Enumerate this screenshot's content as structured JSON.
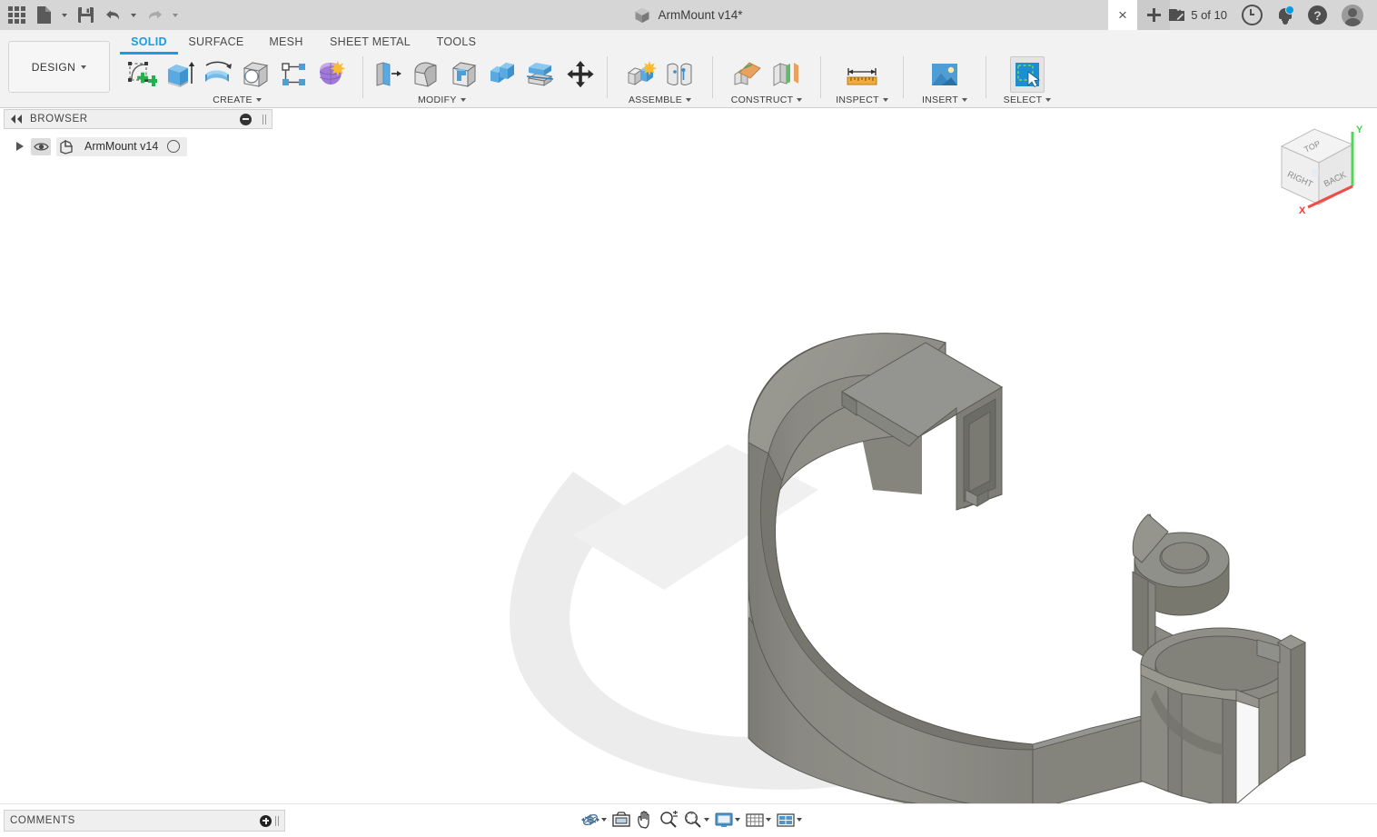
{
  "window": {
    "title": "ArmMount v14*",
    "doc_icon": "cube-icon"
  },
  "quick_access": {
    "apps_label": "apps-grid-icon",
    "new_label": "new-document-icon",
    "save_label": "save-icon",
    "undo_label": "undo-icon",
    "redo_label": "redo-icon"
  },
  "title_right": {
    "close_label": "×",
    "new_tab_label": "+",
    "jobs_count": "5 of 10",
    "jobs_icon": "job-status-icon",
    "clock_icon": "recent-clock-icon",
    "bell_icon": "notifications-bell-icon",
    "help_icon": "help-question-icon",
    "avatar_icon": "user-avatar-icon"
  },
  "ribbon": {
    "workspace": "DESIGN",
    "tabs": [
      {
        "label": "SOLID",
        "active": true
      },
      {
        "label": "SURFACE",
        "active": false
      },
      {
        "label": "MESH",
        "active": false
      },
      {
        "label": "SHEET METAL",
        "active": false
      },
      {
        "label": "TOOLS",
        "active": false
      }
    ],
    "groups": [
      {
        "label": "CREATE",
        "has_dropdown": true,
        "items": [
          {
            "name": "create-sketch",
            "icon": "sketch-plus-icon"
          },
          {
            "name": "extrude",
            "icon": "extrude-icon"
          },
          {
            "name": "revolve",
            "icon": "revolve-icon"
          },
          {
            "name": "hole",
            "icon": "hole-icon"
          },
          {
            "name": "pattern",
            "icon": "rectangular-pattern-icon"
          },
          {
            "name": "create-form",
            "icon": "create-form-icon"
          }
        ]
      },
      {
        "label": "MODIFY",
        "has_dropdown": true,
        "items": [
          {
            "name": "press-pull",
            "icon": "press-pull-icon"
          },
          {
            "name": "fillet",
            "icon": "fillet-icon"
          },
          {
            "name": "shell",
            "icon": "shell-icon"
          },
          {
            "name": "combine",
            "icon": "combine-icon"
          },
          {
            "name": "split-face",
            "icon": "split-face-icon"
          },
          {
            "name": "move-copy",
            "icon": "move-arrows-icon"
          }
        ]
      },
      {
        "label": "ASSEMBLE",
        "has_dropdown": true,
        "items": [
          {
            "name": "new-component",
            "icon": "new-component-icon"
          },
          {
            "name": "joint",
            "icon": "joint-icon"
          }
        ]
      },
      {
        "label": "CONSTRUCT",
        "has_dropdown": true,
        "items": [
          {
            "name": "offset-plane",
            "icon": "offset-plane-icon"
          },
          {
            "name": "plane-at-angle",
            "icon": "plane-at-angle-icon"
          }
        ]
      },
      {
        "label": "INSPECT",
        "has_dropdown": true,
        "items": [
          {
            "name": "measure",
            "icon": "measure-ruler-icon"
          }
        ]
      },
      {
        "label": "INSERT",
        "has_dropdown": true,
        "items": [
          {
            "name": "insert-image",
            "icon": "insert-image-icon"
          }
        ]
      },
      {
        "label": "SELECT",
        "has_dropdown": true,
        "items": [
          {
            "name": "select",
            "icon": "select-cursor-icon"
          }
        ]
      }
    ]
  },
  "browser": {
    "title": "BROWSER",
    "collapse_icon": "collapse-left-icon",
    "minimize_icon": "minimize-icon",
    "root": {
      "expand_icon": "expand-triangle-icon",
      "visibility_icon": "eye-icon",
      "body_icon": "component-icon",
      "label": "ArmMount v14",
      "status_icon": "circle-icon"
    }
  },
  "viewcube": {
    "faces": {
      "top": "TOP",
      "right": "RIGHT",
      "back": "BACK"
    },
    "axis_x": "X",
    "axis_y": "Y",
    "axis_x_color": "#e8433f",
    "axis_y_color": "#3fd246"
  },
  "canvas": {
    "background": "#ffffff",
    "model_name": "ArmMount v14",
    "material_top_color": "#92928b",
    "material_side_color": "#85857e",
    "material_dark_color": "#777770",
    "shadow_color": "#e8e8e8"
  },
  "comments": {
    "title": "COMMENTS",
    "add_icon": "add-comment-icon"
  },
  "navbar": {
    "items": [
      {
        "name": "orbit",
        "icon": "orbit-icon",
        "dropdown": true
      },
      {
        "name": "look-at",
        "icon": "look-at-icon",
        "dropdown": false
      },
      {
        "name": "pan",
        "icon": "pan-hand-icon",
        "dropdown": false
      },
      {
        "name": "zoom",
        "icon": "zoom-icon",
        "dropdown": false
      },
      {
        "name": "fit",
        "icon": "fit-window-icon",
        "dropdown": true
      },
      {
        "name": "display-settings",
        "icon": "display-monitor-icon",
        "dropdown": true
      },
      {
        "name": "grid-snaps",
        "icon": "grid-icon",
        "dropdown": true
      },
      {
        "name": "viewports",
        "icon": "viewport-layout-icon",
        "dropdown": true
      }
    ]
  }
}
